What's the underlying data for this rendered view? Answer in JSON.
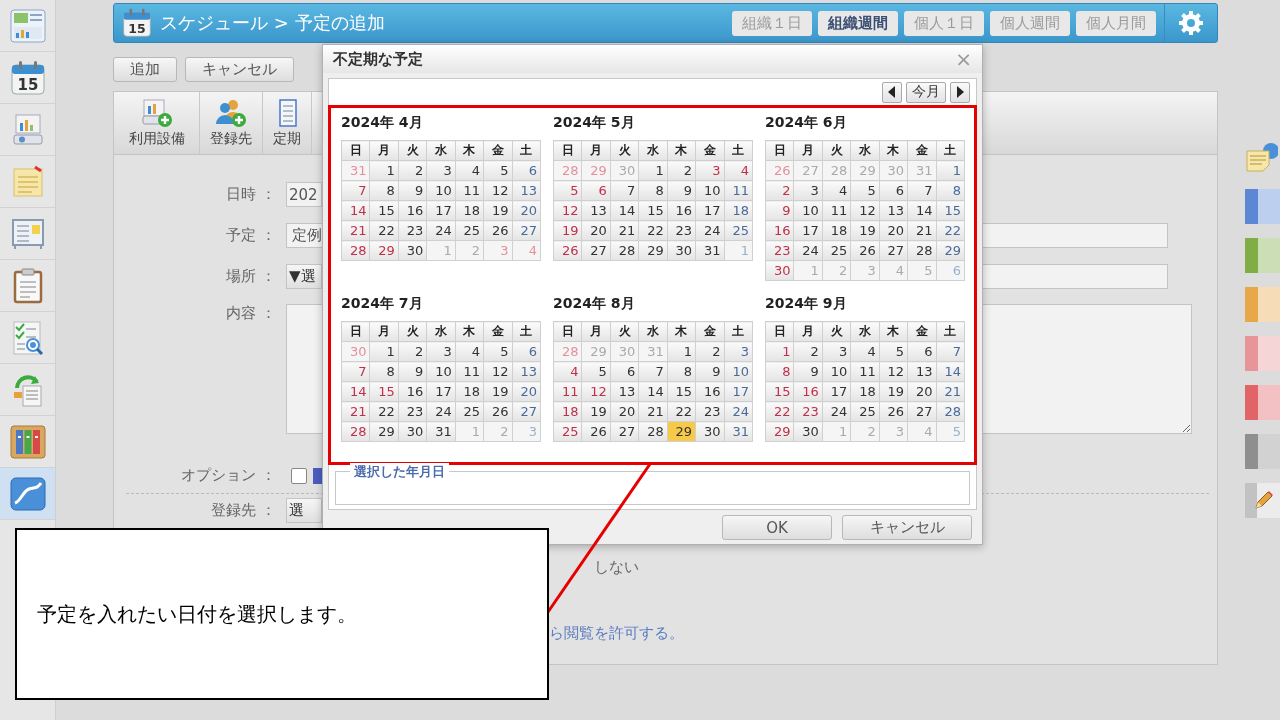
{
  "sidebar": {
    "items": [
      {
        "kind": "dashboard",
        "selected": false
      },
      {
        "kind": "calendar",
        "day": "15",
        "selected": false
      },
      {
        "kind": "projector",
        "selected": false
      },
      {
        "kind": "memo",
        "selected": false
      },
      {
        "kind": "board",
        "selected": false
      },
      {
        "kind": "clipboard",
        "selected": false
      },
      {
        "kind": "checklist",
        "selected": false
      },
      {
        "kind": "recycle",
        "selected": false
      },
      {
        "kind": "binders",
        "selected": false
      },
      {
        "kind": "chart",
        "selected": true
      }
    ]
  },
  "header": {
    "icon_day": "15",
    "title": "スケジュール > 予定の追加",
    "tabs": [
      {
        "label": "組織１日",
        "selected": false
      },
      {
        "label": "組織週間",
        "selected": true
      },
      {
        "label": "個人１日",
        "selected": false
      },
      {
        "label": "個人週間",
        "selected": false
      },
      {
        "label": "個人月間",
        "selected": false
      }
    ]
  },
  "actions": [
    "追加",
    "キャンセル"
  ],
  "toolbar": [
    {
      "kind": "facility",
      "label": "利用設備"
    },
    {
      "kind": "registrant",
      "label": "登録先"
    },
    {
      "kind": "periodic",
      "label": "定期"
    }
  ],
  "form": {
    "datetime": {
      "label": "日時 ：",
      "value": "202"
    },
    "schedule": {
      "label": "予定 ：",
      "value": "定例"
    },
    "place": {
      "label": "場所 ：",
      "select": "▼選"
    },
    "content": {
      "label": "内容 ："
    },
    "option": {
      "label": "オプション ：",
      "checked": false
    },
    "registrant": {
      "label": "登録先 ：",
      "button": "選"
    },
    "notice_fragment": "しない",
    "permission_link": "ら閲覧を許可する。"
  },
  "right_palette": {
    "swatches": [
      {
        "color": "#5b87d5"
      },
      {
        "color": "#80ad45"
      },
      {
        "color": "#e8a84a"
      },
      {
        "color": "#e8959a"
      },
      {
        "color": "#e06468"
      },
      {
        "color": "#8f8f8f"
      }
    ]
  },
  "dialog": {
    "title": "不定期な予定",
    "close": "×",
    "today_button": "今月",
    "months": [
      {
        "title": "2024年 4月",
        "weekdays": [
          "日",
          "月",
          "火",
          "水",
          "木",
          "金",
          "土"
        ],
        "weeks": [
          [
            {
              "day": "31",
              "outside": true,
              "holiday": true,
              "selected": false
            },
            {
              "day": "1",
              "outside": false,
              "holiday": false,
              "selected": false
            },
            {
              "day": "2",
              "outside": false,
              "holiday": false,
              "selected": false
            },
            {
              "day": "3",
              "outside": false,
              "holiday": false,
              "selected": false
            },
            {
              "day": "4",
              "outside": false,
              "holiday": false,
              "selected": false
            },
            {
              "day": "5",
              "outside": false,
              "holiday": false,
              "selected": false
            },
            {
              "day": "6",
              "outside": false,
              "holiday": false,
              "selected": false
            }
          ],
          [
            {
              "day": "7",
              "outside": false,
              "holiday": true,
              "selected": false
            },
            {
              "day": "8",
              "outside": false,
              "holiday": false,
              "selected": false
            },
            {
              "day": "9",
              "outside": false,
              "holiday": false,
              "selected": false
            },
            {
              "day": "10",
              "outside": false,
              "holiday": false,
              "selected": false
            },
            {
              "day": "11",
              "outside": false,
              "holiday": false,
              "selected": false
            },
            {
              "day": "12",
              "outside": false,
              "holiday": false,
              "selected": false
            },
            {
              "day": "13",
              "outside": false,
              "holiday": false,
              "selected": false
            }
          ],
          [
            {
              "day": "14",
              "outside": false,
              "holiday": true,
              "selected": false
            },
            {
              "day": "15",
              "outside": false,
              "holiday": false,
              "selected": false
            },
            {
              "day": "16",
              "outside": false,
              "holiday": false,
              "selected": false
            },
            {
              "day": "17",
              "outside": false,
              "holiday": false,
              "selected": false
            },
            {
              "day": "18",
              "outside": false,
              "holiday": false,
              "selected": false
            },
            {
              "day": "19",
              "outside": false,
              "holiday": false,
              "selected": false
            },
            {
              "day": "20",
              "outside": false,
              "holiday": false,
              "selected": false
            }
          ],
          [
            {
              "day": "21",
              "outside": false,
              "holiday": true,
              "selected": false
            },
            {
              "day": "22",
              "outside": false,
              "holiday": false,
              "selected": false
            },
            {
              "day": "23",
              "outside": false,
              "holiday": false,
              "selected": false
            },
            {
              "day": "24",
              "outside": false,
              "holiday": false,
              "selected": false
            },
            {
              "day": "25",
              "outside": false,
              "holiday": false,
              "selected": false
            },
            {
              "day": "26",
              "outside": false,
              "holiday": false,
              "selected": false
            },
            {
              "day": "27",
              "outside": false,
              "holiday": false,
              "selected": false
            }
          ],
          [
            {
              "day": "28",
              "outside": false,
              "holiday": true,
              "selected": false
            },
            {
              "day": "29",
              "outside": false,
              "holiday": true,
              "selected": false
            },
            {
              "day": "30",
              "outside": false,
              "holiday": false,
              "selected": false
            },
            {
              "day": "1",
              "outside": true,
              "holiday": false,
              "selected": false
            },
            {
              "day": "2",
              "outside": true,
              "holiday": false,
              "selected": false
            },
            {
              "day": "3",
              "outside": true,
              "holiday": true,
              "selected": false
            },
            {
              "day": "4",
              "outside": true,
              "holiday": true,
              "selected": false
            }
          ]
        ]
      },
      {
        "title": "2024年 5月",
        "weekdays": [
          "日",
          "月",
          "火",
          "水",
          "木",
          "金",
          "土"
        ],
        "weeks": [
          [
            {
              "day": "28",
              "outside": true,
              "holiday": true,
              "selected": false
            },
            {
              "day": "29",
              "outside": true,
              "holiday": true,
              "selected": false
            },
            {
              "day": "30",
              "outside": true,
              "holiday": false,
              "selected": false
            },
            {
              "day": "1",
              "outside": false,
              "holiday": false,
              "selected": false
            },
            {
              "day": "2",
              "outside": false,
              "holiday": false,
              "selected": false
            },
            {
              "day": "3",
              "outside": false,
              "holiday": true,
              "selected": false
            },
            {
              "day": "4",
              "outside": false,
              "holiday": true,
              "selected": false
            }
          ],
          [
            {
              "day": "5",
              "outside": false,
              "holiday": true,
              "selected": false
            },
            {
              "day": "6",
              "outside": false,
              "holiday": true,
              "selected": false
            },
            {
              "day": "7",
              "outside": false,
              "holiday": false,
              "selected": false
            },
            {
              "day": "8",
              "outside": false,
              "holiday": false,
              "selected": false
            },
            {
              "day": "9",
              "outside": false,
              "holiday": false,
              "selected": false
            },
            {
              "day": "10",
              "outside": false,
              "holiday": false,
              "selected": false
            },
            {
              "day": "11",
              "outside": false,
              "holiday": false,
              "selected": false
            }
          ],
          [
            {
              "day": "12",
              "outside": false,
              "holiday": true,
              "selected": false
            },
            {
              "day": "13",
              "outside": false,
              "holiday": false,
              "selected": false
            },
            {
              "day": "14",
              "outside": false,
              "holiday": false,
              "selected": false
            },
            {
              "day": "15",
              "outside": false,
              "holiday": false,
              "selected": false
            },
            {
              "day": "16",
              "outside": false,
              "holiday": false,
              "selected": false
            },
            {
              "day": "17",
              "outside": false,
              "holiday": false,
              "selected": false
            },
            {
              "day": "18",
              "outside": false,
              "holiday": false,
              "selected": false
            }
          ],
          [
            {
              "day": "19",
              "outside": false,
              "holiday": true,
              "selected": false
            },
            {
              "day": "20",
              "outside": false,
              "holiday": false,
              "selected": false
            },
            {
              "day": "21",
              "outside": false,
              "holiday": false,
              "selected": false
            },
            {
              "day": "22",
              "outside": false,
              "holiday": false,
              "selected": false
            },
            {
              "day": "23",
              "outside": false,
              "holiday": false,
              "selected": false
            },
            {
              "day": "24",
              "outside": false,
              "holiday": false,
              "selected": false
            },
            {
              "day": "25",
              "outside": false,
              "holiday": false,
              "selected": false
            }
          ],
          [
            {
              "day": "26",
              "outside": false,
              "holiday": true,
              "selected": false
            },
            {
              "day": "27",
              "outside": false,
              "holiday": false,
              "selected": false
            },
            {
              "day": "28",
              "outside": false,
              "holiday": false,
              "selected": false
            },
            {
              "day": "29",
              "outside": false,
              "holiday": false,
              "selected": false
            },
            {
              "day": "30",
              "outside": false,
              "holiday": false,
              "selected": false
            },
            {
              "day": "31",
              "outside": false,
              "holiday": false,
              "selected": false
            },
            {
              "day": "1",
              "outside": true,
              "holiday": false,
              "selected": false
            }
          ]
        ]
      },
      {
        "title": "2024年 6月",
        "weekdays": [
          "日",
          "月",
          "火",
          "水",
          "木",
          "金",
          "土"
        ],
        "weeks": [
          [
            {
              "day": "26",
              "outside": true,
              "holiday": true,
              "selected": false
            },
            {
              "day": "27",
              "outside": true,
              "holiday": false,
              "selected": false
            },
            {
              "day": "28",
              "outside": true,
              "holiday": false,
              "selected": false
            },
            {
              "day": "29",
              "outside": true,
              "holiday": false,
              "selected": false
            },
            {
              "day": "30",
              "outside": true,
              "holiday": false,
              "selected": false
            },
            {
              "day": "31",
              "outside": true,
              "holiday": false,
              "selected": false
            },
            {
              "day": "1",
              "outside": false,
              "holiday": false,
              "selected": false
            }
          ],
          [
            {
              "day": "2",
              "outside": false,
              "holiday": true,
              "selected": false
            },
            {
              "day": "3",
              "outside": false,
              "holiday": false,
              "selected": false
            },
            {
              "day": "4",
              "outside": false,
              "holiday": false,
              "selected": false
            },
            {
              "day": "5",
              "outside": false,
              "holiday": false,
              "selected": false
            },
            {
              "day": "6",
              "outside": false,
              "holiday": false,
              "selected": false
            },
            {
              "day": "7",
              "outside": false,
              "holiday": false,
              "selected": false
            },
            {
              "day": "8",
              "outside": false,
              "holiday": false,
              "selected": false
            }
          ],
          [
            {
              "day": "9",
              "outside": false,
              "holiday": true,
              "selected": false
            },
            {
              "day": "10",
              "outside": false,
              "holiday": false,
              "selected": false
            },
            {
              "day": "11",
              "outside": false,
              "holiday": false,
              "selected": false
            },
            {
              "day": "12",
              "outside": false,
              "holiday": false,
              "selected": false
            },
            {
              "day": "13",
              "outside": false,
              "holiday": false,
              "selected": false
            },
            {
              "day": "14",
              "outside": false,
              "holiday": false,
              "selected": false
            },
            {
              "day": "15",
              "outside": false,
              "holiday": false,
              "selected": false
            }
          ],
          [
            {
              "day": "16",
              "outside": false,
              "holiday": true,
              "selected": false
            },
            {
              "day": "17",
              "outside": false,
              "holiday": false,
              "selected": false
            },
            {
              "day": "18",
              "outside": false,
              "holiday": false,
              "selected": false
            },
            {
              "day": "19",
              "outside": false,
              "holiday": false,
              "selected": false
            },
            {
              "day": "20",
              "outside": false,
              "holiday": false,
              "selected": false
            },
            {
              "day": "21",
              "outside": false,
              "holiday": false,
              "selected": false
            },
            {
              "day": "22",
              "outside": false,
              "holiday": false,
              "selected": false
            }
          ],
          [
            {
              "day": "23",
              "outside": false,
              "holiday": true,
              "selected": false
            },
            {
              "day": "24",
              "outside": false,
              "holiday": false,
              "selected": false
            },
            {
              "day": "25",
              "outside": false,
              "holiday": false,
              "selected": false
            },
            {
              "day": "26",
              "outside": false,
              "holiday": false,
              "selected": false
            },
            {
              "day": "27",
              "outside": false,
              "holiday": false,
              "selected": false
            },
            {
              "day": "28",
              "outside": false,
              "holiday": false,
              "selected": false
            },
            {
              "day": "29",
              "outside": false,
              "holiday": false,
              "selected": false
            }
          ],
          [
            {
              "day": "30",
              "outside": false,
              "holiday": true,
              "selected": false
            },
            {
              "day": "1",
              "outside": true,
              "holiday": false,
              "selected": false
            },
            {
              "day": "2",
              "outside": true,
              "holiday": false,
              "selected": false
            },
            {
              "day": "3",
              "outside": true,
              "holiday": false,
              "selected": false
            },
            {
              "day": "4",
              "outside": true,
              "holiday": false,
              "selected": false
            },
            {
              "day": "5",
              "outside": true,
              "holiday": false,
              "selected": false
            },
            {
              "day": "6",
              "outside": true,
              "holiday": false,
              "selected": false
            }
          ]
        ]
      },
      {
        "title": "2024年 7月",
        "weekdays": [
          "日",
          "月",
          "火",
          "水",
          "木",
          "金",
          "土"
        ],
        "weeks": [
          [
            {
              "day": "30",
              "outside": true,
              "holiday": true,
              "selected": false
            },
            {
              "day": "1",
              "outside": false,
              "holiday": false,
              "selected": false
            },
            {
              "day": "2",
              "outside": false,
              "holiday": false,
              "selected": false
            },
            {
              "day": "3",
              "outside": false,
              "holiday": false,
              "selected": false
            },
            {
              "day": "4",
              "outside": false,
              "holiday": false,
              "selected": false
            },
            {
              "day": "5",
              "outside": false,
              "holiday": false,
              "selected": false
            },
            {
              "day": "6",
              "outside": false,
              "holiday": false,
              "selected": false
            }
          ],
          [
            {
              "day": "7",
              "outside": false,
              "holiday": true,
              "selected": false
            },
            {
              "day": "8",
              "outside": false,
              "holiday": false,
              "selected": false
            },
            {
              "day": "9",
              "outside": false,
              "holiday": false,
              "selected": false
            },
            {
              "day": "10",
              "outside": false,
              "holiday": false,
              "selected": false
            },
            {
              "day": "11",
              "outside": false,
              "holiday": false,
              "selected": false
            },
            {
              "day": "12",
              "outside": false,
              "holiday": false,
              "selected": false
            },
            {
              "day": "13",
              "outside": false,
              "holiday": false,
              "selected": false
            }
          ],
          [
            {
              "day": "14",
              "outside": false,
              "holiday": true,
              "selected": false
            },
            {
              "day": "15",
              "outside": false,
              "holiday": true,
              "selected": false
            },
            {
              "day": "16",
              "outside": false,
              "holiday": false,
              "selected": false
            },
            {
              "day": "17",
              "outside": false,
              "holiday": false,
              "selected": false
            },
            {
              "day": "18",
              "outside": false,
              "holiday": false,
              "selected": false
            },
            {
              "day": "19",
              "outside": false,
              "holiday": false,
              "selected": false
            },
            {
              "day": "20",
              "outside": false,
              "holiday": false,
              "selected": false
            }
          ],
          [
            {
              "day": "21",
              "outside": false,
              "holiday": true,
              "selected": false
            },
            {
              "day": "22",
              "outside": false,
              "holiday": false,
              "selected": false
            },
            {
              "day": "23",
              "outside": false,
              "holiday": false,
              "selected": false
            },
            {
              "day": "24",
              "outside": false,
              "holiday": false,
              "selected": false
            },
            {
              "day": "25",
              "outside": false,
              "holiday": false,
              "selected": false
            },
            {
              "day": "26",
              "outside": false,
              "holiday": false,
              "selected": false
            },
            {
              "day": "27",
              "outside": false,
              "holiday": false,
              "selected": false
            }
          ],
          [
            {
              "day": "28",
              "outside": false,
              "holiday": true,
              "selected": false
            },
            {
              "day": "29",
              "outside": false,
              "holiday": false,
              "selected": false
            },
            {
              "day": "30",
              "outside": false,
              "holiday": false,
              "selected": false
            },
            {
              "day": "31",
              "outside": false,
              "holiday": false,
              "selected": false
            },
            {
              "day": "1",
              "outside": true,
              "holiday": false,
              "selected": false
            },
            {
              "day": "2",
              "outside": true,
              "holiday": false,
              "selected": false
            },
            {
              "day": "3",
              "outside": true,
              "holiday": false,
              "selected": false
            }
          ]
        ]
      },
      {
        "title": "2024年 8月",
        "weekdays": [
          "日",
          "月",
          "火",
          "水",
          "木",
          "金",
          "土"
        ],
        "weeks": [
          [
            {
              "day": "28",
              "outside": true,
              "holiday": true,
              "selected": false
            },
            {
              "day": "29",
              "outside": true,
              "holiday": false,
              "selected": false
            },
            {
              "day": "30",
              "outside": true,
              "holiday": false,
              "selected": false
            },
            {
              "day": "31",
              "outside": true,
              "holiday": false,
              "selected": false
            },
            {
              "day": "1",
              "outside": false,
              "holiday": false,
              "selected": false
            },
            {
              "day": "2",
              "outside": false,
              "holiday": false,
              "selected": false
            },
            {
              "day": "3",
              "outside": false,
              "holiday": false,
              "selected": false
            }
          ],
          [
            {
              "day": "4",
              "outside": false,
              "holiday": true,
              "selected": false
            },
            {
              "day": "5",
              "outside": false,
              "holiday": false,
              "selected": false
            },
            {
              "day": "6",
              "outside": false,
              "holiday": false,
              "selected": false
            },
            {
              "day": "7",
              "outside": false,
              "holiday": false,
              "selected": false
            },
            {
              "day": "8",
              "outside": false,
              "holiday": false,
              "selected": false
            },
            {
              "day": "9",
              "outside": false,
              "holiday": false,
              "selected": false
            },
            {
              "day": "10",
              "outside": false,
              "holiday": false,
              "selected": false
            }
          ],
          [
            {
              "day": "11",
              "outside": false,
              "holiday": true,
              "selected": false
            },
            {
              "day": "12",
              "outside": false,
              "holiday": true,
              "selected": false
            },
            {
              "day": "13",
              "outside": false,
              "holiday": false,
              "selected": false
            },
            {
              "day": "14",
              "outside": false,
              "holiday": false,
              "selected": false
            },
            {
              "day": "15",
              "outside": false,
              "holiday": false,
              "selected": false
            },
            {
              "day": "16",
              "outside": false,
              "holiday": false,
              "selected": false
            },
            {
              "day": "17",
              "outside": false,
              "holiday": false,
              "selected": false
            }
          ],
          [
            {
              "day": "18",
              "outside": false,
              "holiday": true,
              "selected": false
            },
            {
              "day": "19",
              "outside": false,
              "holiday": false,
              "selected": false
            },
            {
              "day": "20",
              "outside": false,
              "holiday": false,
              "selected": false
            },
            {
              "day": "21",
              "outside": false,
              "holiday": false,
              "selected": false
            },
            {
              "day": "22",
              "outside": false,
              "holiday": false,
              "selected": false
            },
            {
              "day": "23",
              "outside": false,
              "holiday": false,
              "selected": false
            },
            {
              "day": "24",
              "outside": false,
              "holiday": false,
              "selected": false
            }
          ],
          [
            {
              "day": "25",
              "outside": false,
              "holiday": true,
              "selected": false
            },
            {
              "day": "26",
              "outside": false,
              "holiday": false,
              "selected": false
            },
            {
              "day": "27",
              "outside": false,
              "holiday": false,
              "selected": false
            },
            {
              "day": "28",
              "outside": false,
              "holiday": false,
              "selected": false
            },
            {
              "day": "29",
              "outside": false,
              "holiday": false,
              "selected": true
            },
            {
              "day": "30",
              "outside": false,
              "holiday": false,
              "selected": false
            },
            {
              "day": "31",
              "outside": false,
              "holiday": false,
              "selected": false
            }
          ]
        ]
      },
      {
        "title": "2024年 9月",
        "weekdays": [
          "日",
          "月",
          "火",
          "水",
          "木",
          "金",
          "土"
        ],
        "weeks": [
          [
            {
              "day": "1",
              "outside": false,
              "holiday": true,
              "selected": false
            },
            {
              "day": "2",
              "outside": false,
              "holiday": false,
              "selected": false
            },
            {
              "day": "3",
              "outside": false,
              "holiday": false,
              "selected": false
            },
            {
              "day": "4",
              "outside": false,
              "holiday": false,
              "selected": false
            },
            {
              "day": "5",
              "outside": false,
              "holiday": false,
              "selected": false
            },
            {
              "day": "6",
              "outside": false,
              "holiday": false,
              "selected": false
            },
            {
              "day": "7",
              "outside": false,
              "holiday": false,
              "selected": false
            }
          ],
          [
            {
              "day": "8",
              "outside": false,
              "holiday": true,
              "selected": false
            },
            {
              "day": "9",
              "outside": false,
              "holiday": false,
              "selected": false
            },
            {
              "day": "10",
              "outside": false,
              "holiday": false,
              "selected": false
            },
            {
              "day": "11",
              "outside": false,
              "holiday": false,
              "selected": false
            },
            {
              "day": "12",
              "outside": false,
              "holiday": false,
              "selected": false
            },
            {
              "day": "13",
              "outside": false,
              "holiday": false,
              "selected": false
            },
            {
              "day": "14",
              "outside": false,
              "holiday": false,
              "selected": false
            }
          ],
          [
            {
              "day": "15",
              "outside": false,
              "holiday": true,
              "selected": false
            },
            {
              "day": "16",
              "outside": false,
              "holiday": true,
              "selected": false
            },
            {
              "day": "17",
              "outside": false,
              "holiday": false,
              "selected": false
            },
            {
              "day": "18",
              "outside": false,
              "holiday": false,
              "selected": false
            },
            {
              "day": "19",
              "outside": false,
              "holiday": false,
              "selected": false
            },
            {
              "day": "20",
              "outside": false,
              "holiday": false,
              "selected": false
            },
            {
              "day": "21",
              "outside": false,
              "holiday": false,
              "selected": false
            }
          ],
          [
            {
              "day": "22",
              "outside": false,
              "holiday": true,
              "selected": false
            },
            {
              "day": "23",
              "outside": false,
              "holiday": true,
              "selected": false
            },
            {
              "day": "24",
              "outside": false,
              "holiday": false,
              "selected": false
            },
            {
              "day": "25",
              "outside": false,
              "holiday": false,
              "selected": false
            },
            {
              "day": "26",
              "outside": false,
              "holiday": false,
              "selected": false
            },
            {
              "day": "27",
              "outside": false,
              "holiday": false,
              "selected": false
            },
            {
              "day": "28",
              "outside": false,
              "holiday": false,
              "selected": false
            }
          ],
          [
            {
              "day": "29",
              "outside": false,
              "holiday": true,
              "selected": false
            },
            {
              "day": "30",
              "outside": false,
              "holiday": false,
              "selected": false
            },
            {
              "day": "1",
              "outside": true,
              "holiday": false,
              "selected": false
            },
            {
              "day": "2",
              "outside": true,
              "holiday": false,
              "selected": false
            },
            {
              "day": "3",
              "outside": true,
              "holiday": false,
              "selected": false
            },
            {
              "day": "4",
              "outside": true,
              "holiday": false,
              "selected": false
            },
            {
              "day": "5",
              "outside": true,
              "holiday": false,
              "selected": false
            }
          ]
        ]
      }
    ],
    "selected_dates_legend": "選択した年月日",
    "buttons": [
      "OK",
      "キャンセル"
    ]
  },
  "callout": {
    "text": "予定を入れたい日付を選択します。"
  }
}
